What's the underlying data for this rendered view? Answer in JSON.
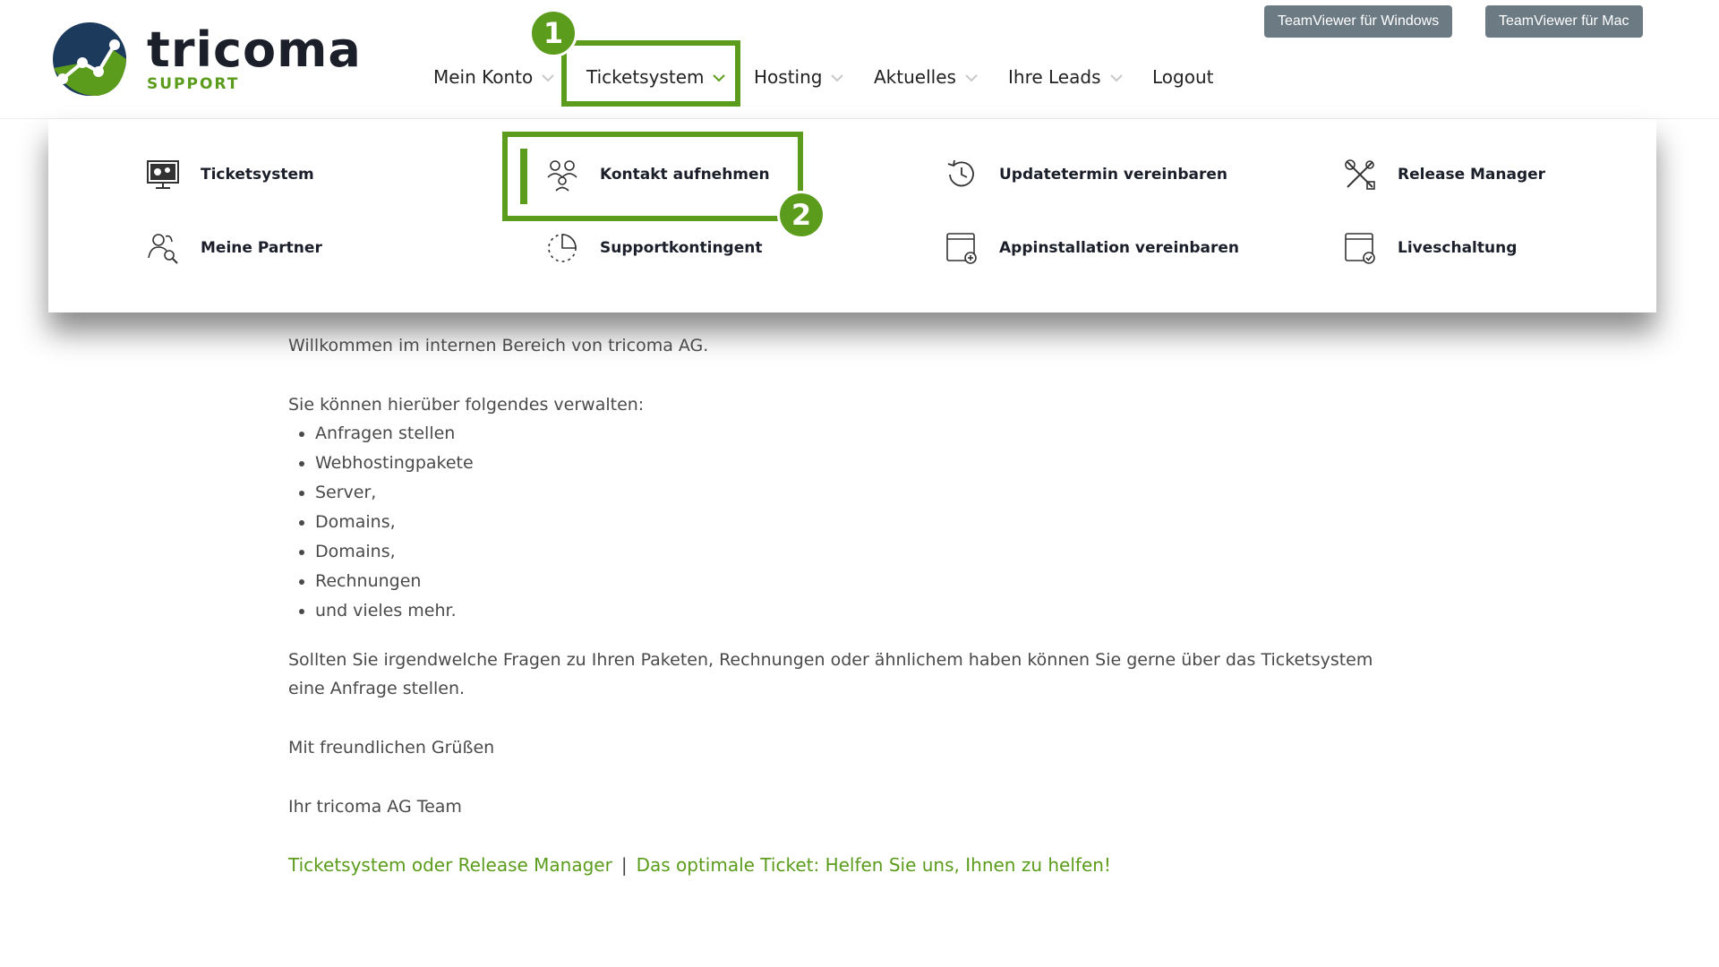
{
  "header": {
    "logo_word": "tricoma",
    "logo_sub": "SUPPORT",
    "teamviewer_windows": "TeamViewer für Windows",
    "teamviewer_mac": "TeamViewer für Mac"
  },
  "nav": {
    "items": [
      {
        "label": "Mein Konto",
        "icon": "chevron-down-icon"
      },
      {
        "label": "Ticketsystem",
        "icon": "chevron-down-icon"
      },
      {
        "label": "Hosting",
        "icon": "chevron-down-icon"
      },
      {
        "label": "Aktuelles",
        "icon": "chevron-down-icon"
      },
      {
        "label": "Ihre Leads",
        "icon": "chevron-down-icon"
      },
      {
        "label": "Logout"
      }
    ]
  },
  "annotations": {
    "step1": "1",
    "step2": "2"
  },
  "mega_menu": {
    "items": [
      {
        "label": "Ticketsystem",
        "icon": "monitor-gear-icon"
      },
      {
        "label": "Kontakt aufnehmen",
        "icon": "people-contact-icon"
      },
      {
        "label": "Updatetermin vereinbaren",
        "icon": "clock-history-icon"
      },
      {
        "label": "Release Manager",
        "icon": "tools-icon"
      },
      {
        "label": "Meine Partner",
        "icon": "user-search-icon"
      },
      {
        "label": "Supportkontingent",
        "icon": "pie-progress-icon"
      },
      {
        "label": "Appinstallation vereinbaren",
        "icon": "window-add-icon"
      },
      {
        "label": "Liveschaltung",
        "icon": "window-check-icon"
      }
    ]
  },
  "content": {
    "welcome": "Willkommen im internen Bereich von tricoma AG.",
    "intro": "Sie können hierüber folgendes verwalten:",
    "list": [
      "Anfragen stellen",
      "Webhostingpakete",
      "Server,",
      "Domains,",
      "Domains,",
      "Rechnungen",
      "und vieles mehr."
    ],
    "questions": "Sollten Sie irgendwelche Fragen zu Ihren Paketen, Rechnungen oder ähnlichem haben können Sie gerne über das Ticketsystem eine Anfrage stellen.",
    "greeting": "Mit freundlichen Grüßen",
    "signature": "Ihr tricoma AG Team"
  },
  "footer": {
    "link1": "Ticketsystem oder Release Manager",
    "separator": "|",
    "link2": "Das optimale Ticket: Helfen Sie uns, Ihnen zu helfen!"
  },
  "colors": {
    "brand_green": "#5b9c1c",
    "brand_dark": "#1b1f2a",
    "button_gray": "#6c7a84"
  }
}
